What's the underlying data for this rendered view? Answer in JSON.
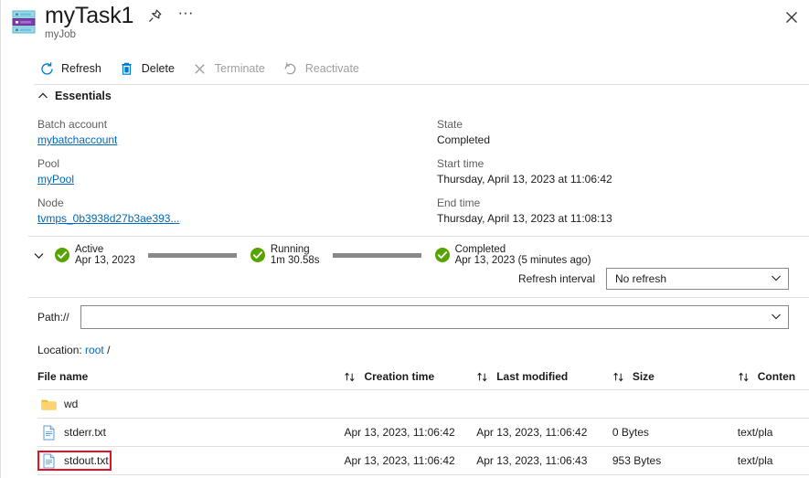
{
  "titlebar": {
    "title": "myTask1",
    "subtitle": "myJob",
    "task_icon": "batch-task-icon",
    "pin_icon": "pin-icon",
    "ellipsis_icon": "ellipsis-icon",
    "ellipsis_glyph": "···",
    "close_icon": "close-icon"
  },
  "commandbar": {
    "items": [
      {
        "label": "Refresh",
        "icon": "refresh-icon",
        "enabled": true
      },
      {
        "label": "Delete",
        "icon": "delete-icon",
        "enabled": true
      },
      {
        "label": "Terminate",
        "icon": "terminate-icon",
        "enabled": false
      },
      {
        "label": "Reactivate",
        "icon": "reactivate-icon",
        "enabled": false
      }
    ]
  },
  "essentials": {
    "header": "Essentials",
    "left": [
      {
        "label": "Batch account",
        "value": "mybatchaccount",
        "is_link": true
      },
      {
        "label": "Pool",
        "value": "myPool",
        "is_link": true
      },
      {
        "label": "Node",
        "value": "tvmps_0b3938d27b3ae393...",
        "is_link": true
      }
    ],
    "right": [
      {
        "label": "State",
        "value": "Completed",
        "is_link": false
      },
      {
        "label": "Start time",
        "value": "Thursday, April 13, 2023 at 11:06:42",
        "is_link": false
      },
      {
        "label": "End time",
        "value": "Thursday, April 13, 2023 at 11:08:13",
        "is_link": false
      }
    ]
  },
  "timeline": {
    "expand_icon": "chevron-down-icon",
    "stages": [
      {
        "name": "Active",
        "detail": "Apr 13, 2023",
        "icon": "check-circle-icon"
      },
      {
        "name": "Running",
        "detail": "1m 30.58s",
        "icon": "check-circle-icon"
      },
      {
        "name": "Completed",
        "detail": "Apr 13, 2023 (5 minutes ago)",
        "icon": "check-circle-icon"
      }
    ]
  },
  "refresh_interval": {
    "label": "Refresh interval",
    "value": "No refresh",
    "chevron_icon": "chevron-down-icon"
  },
  "path": {
    "label": "Path://",
    "value": "",
    "placeholder": "",
    "chevron_icon": "chevron-down-icon"
  },
  "location": {
    "prefix": "Location:",
    "link": "root",
    "separator": "/"
  },
  "table": {
    "columns": [
      {
        "key": "name",
        "label": "File name",
        "sort_icon": null
      },
      {
        "key": "create",
        "label": "Creation time",
        "sort_icon": "sort-icon"
      },
      {
        "key": "mod",
        "label": "Last modified",
        "sort_icon": "sort-icon"
      },
      {
        "key": "size",
        "label": "Size",
        "sort_icon": "sort-icon"
      },
      {
        "key": "type",
        "label": "Conten",
        "sort_icon": "sort-icon"
      }
    ],
    "rows": [
      {
        "name": "wd",
        "icon": "folder-icon",
        "create": "",
        "mod": "",
        "size": "",
        "type": "",
        "highlighted": false
      },
      {
        "name": "stderr.txt",
        "icon": "file-icon",
        "create": "Apr 13, 2023, 11:06:42",
        "mod": "Apr 13, 2023, 11:06:42",
        "size": "0 Bytes",
        "type": "text/pla",
        "highlighted": false
      },
      {
        "name": "stdout.txt",
        "icon": "file-icon",
        "create": "Apr 13, 2023, 11:06:42",
        "mod": "Apr 13, 2023, 11:06:43",
        "size": "953 Bytes",
        "type": "text/pla",
        "highlighted": true
      }
    ]
  },
  "colors": {
    "link": "#0067b8",
    "accent_blue": "#0078d4",
    "success_green": "#107c10",
    "highlight_red": "#e81123",
    "divider": "#e1dfdd",
    "muted_text": "#605e5c"
  }
}
